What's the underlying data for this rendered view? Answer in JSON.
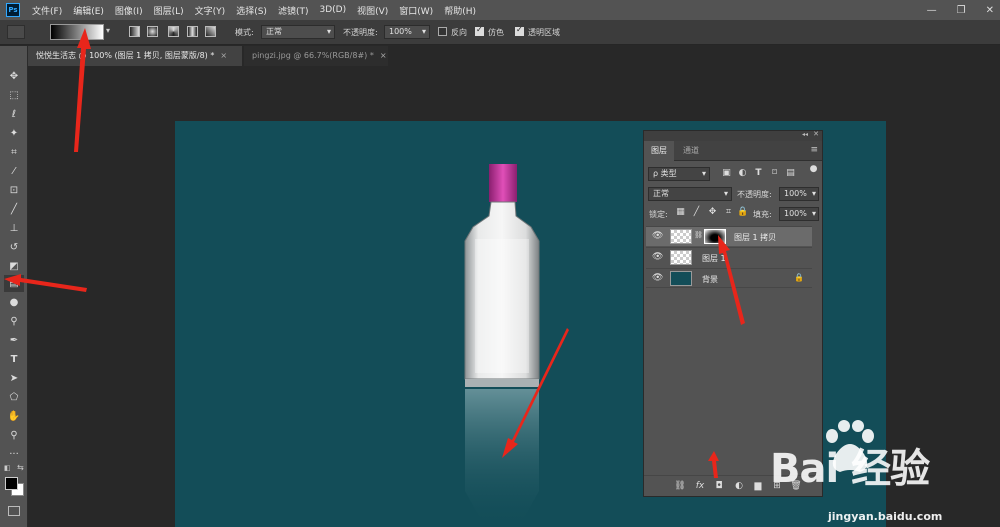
{
  "app": {
    "logo": "Ps",
    "menu": [
      "文件(F)",
      "编辑(E)",
      "图像(I)",
      "图层(L)",
      "文字(Y)",
      "选择(S)",
      "滤镜(T)",
      "3D(D)",
      "视图(V)",
      "窗口(W)",
      "帮助(H)"
    ],
    "window_controls": [
      "—",
      "❐",
      "✕"
    ]
  },
  "options_bar": {
    "mode_label": "模式:",
    "mode_value": "正常",
    "opacity_label": "不透明度:",
    "opacity_value": "100%",
    "reverse_label": "反向",
    "reverse_checked": false,
    "dither_label": "仿色",
    "dither_checked": true,
    "transparency_label": "透明区域",
    "transparency_checked": true
  },
  "doc_tabs": [
    {
      "label": "悦悦生活志 @ 100% (图层 1 拷贝, 图层蒙版/8) *",
      "active": true
    },
    {
      "label": "pingzi.jpg @ 66.7%(RGB/8#) *",
      "active": false
    }
  ],
  "tab_close": "×",
  "tools": [
    {
      "name": "move-tool",
      "glyph": "✥"
    },
    {
      "name": "marquee-tool",
      "glyph": "⬚"
    },
    {
      "name": "lasso-tool",
      "glyph": "ℓ"
    },
    {
      "name": "magic-wand-tool",
      "glyph": "✦"
    },
    {
      "name": "crop-tool",
      "glyph": "⌗"
    },
    {
      "name": "eyedropper-tool",
      "glyph": "⁄"
    },
    {
      "name": "healing-tool",
      "glyph": "⊡"
    },
    {
      "name": "brush-tool",
      "glyph": "╱"
    },
    {
      "name": "stamp-tool",
      "glyph": "⊥"
    },
    {
      "name": "history-brush-tool",
      "glyph": "↺"
    },
    {
      "name": "eraser-tool",
      "glyph": "◩"
    },
    {
      "name": "gradient-tool",
      "glyph": "▤"
    },
    {
      "name": "blur-tool",
      "glyph": "●"
    },
    {
      "name": "dodge-tool",
      "glyph": "⚲"
    },
    {
      "name": "pen-tool",
      "glyph": "✒"
    },
    {
      "name": "type-tool",
      "glyph": "T"
    },
    {
      "name": "path-select-tool",
      "glyph": "➤"
    },
    {
      "name": "shape-tool",
      "glyph": "⬠"
    },
    {
      "name": "hand-tool",
      "glyph": "✋"
    },
    {
      "name": "zoom-tool",
      "glyph": "⚲"
    },
    {
      "name": "more-tools",
      "glyph": "···"
    }
  ],
  "layers_panel": {
    "collapse": "◂◂",
    "close": "✕",
    "tabs": [
      "图层",
      "通道"
    ],
    "menu": "≡",
    "filter_label": "ρ 类型",
    "blend_mode": "正常",
    "opacity_label": "不透明度:",
    "opacity_value": "100%",
    "lock_label": "锁定:",
    "fill_label": "填充:",
    "fill_value": "100%",
    "layers": [
      {
        "name": "图层 1 拷贝",
        "selected": true,
        "has_mask": true
      },
      {
        "name": "图层 1",
        "selected": false,
        "has_mask": false
      },
      {
        "name": "背景",
        "selected": false,
        "locked": true
      }
    ],
    "lock_icon": "🔒",
    "bottom_icons": [
      "⛓",
      "fx",
      "◘",
      "◐",
      "▆",
      "⊞",
      "🗑"
    ]
  },
  "watermark": {
    "brand": "Bai  经验",
    "url": "jingyan.baidu.com"
  }
}
